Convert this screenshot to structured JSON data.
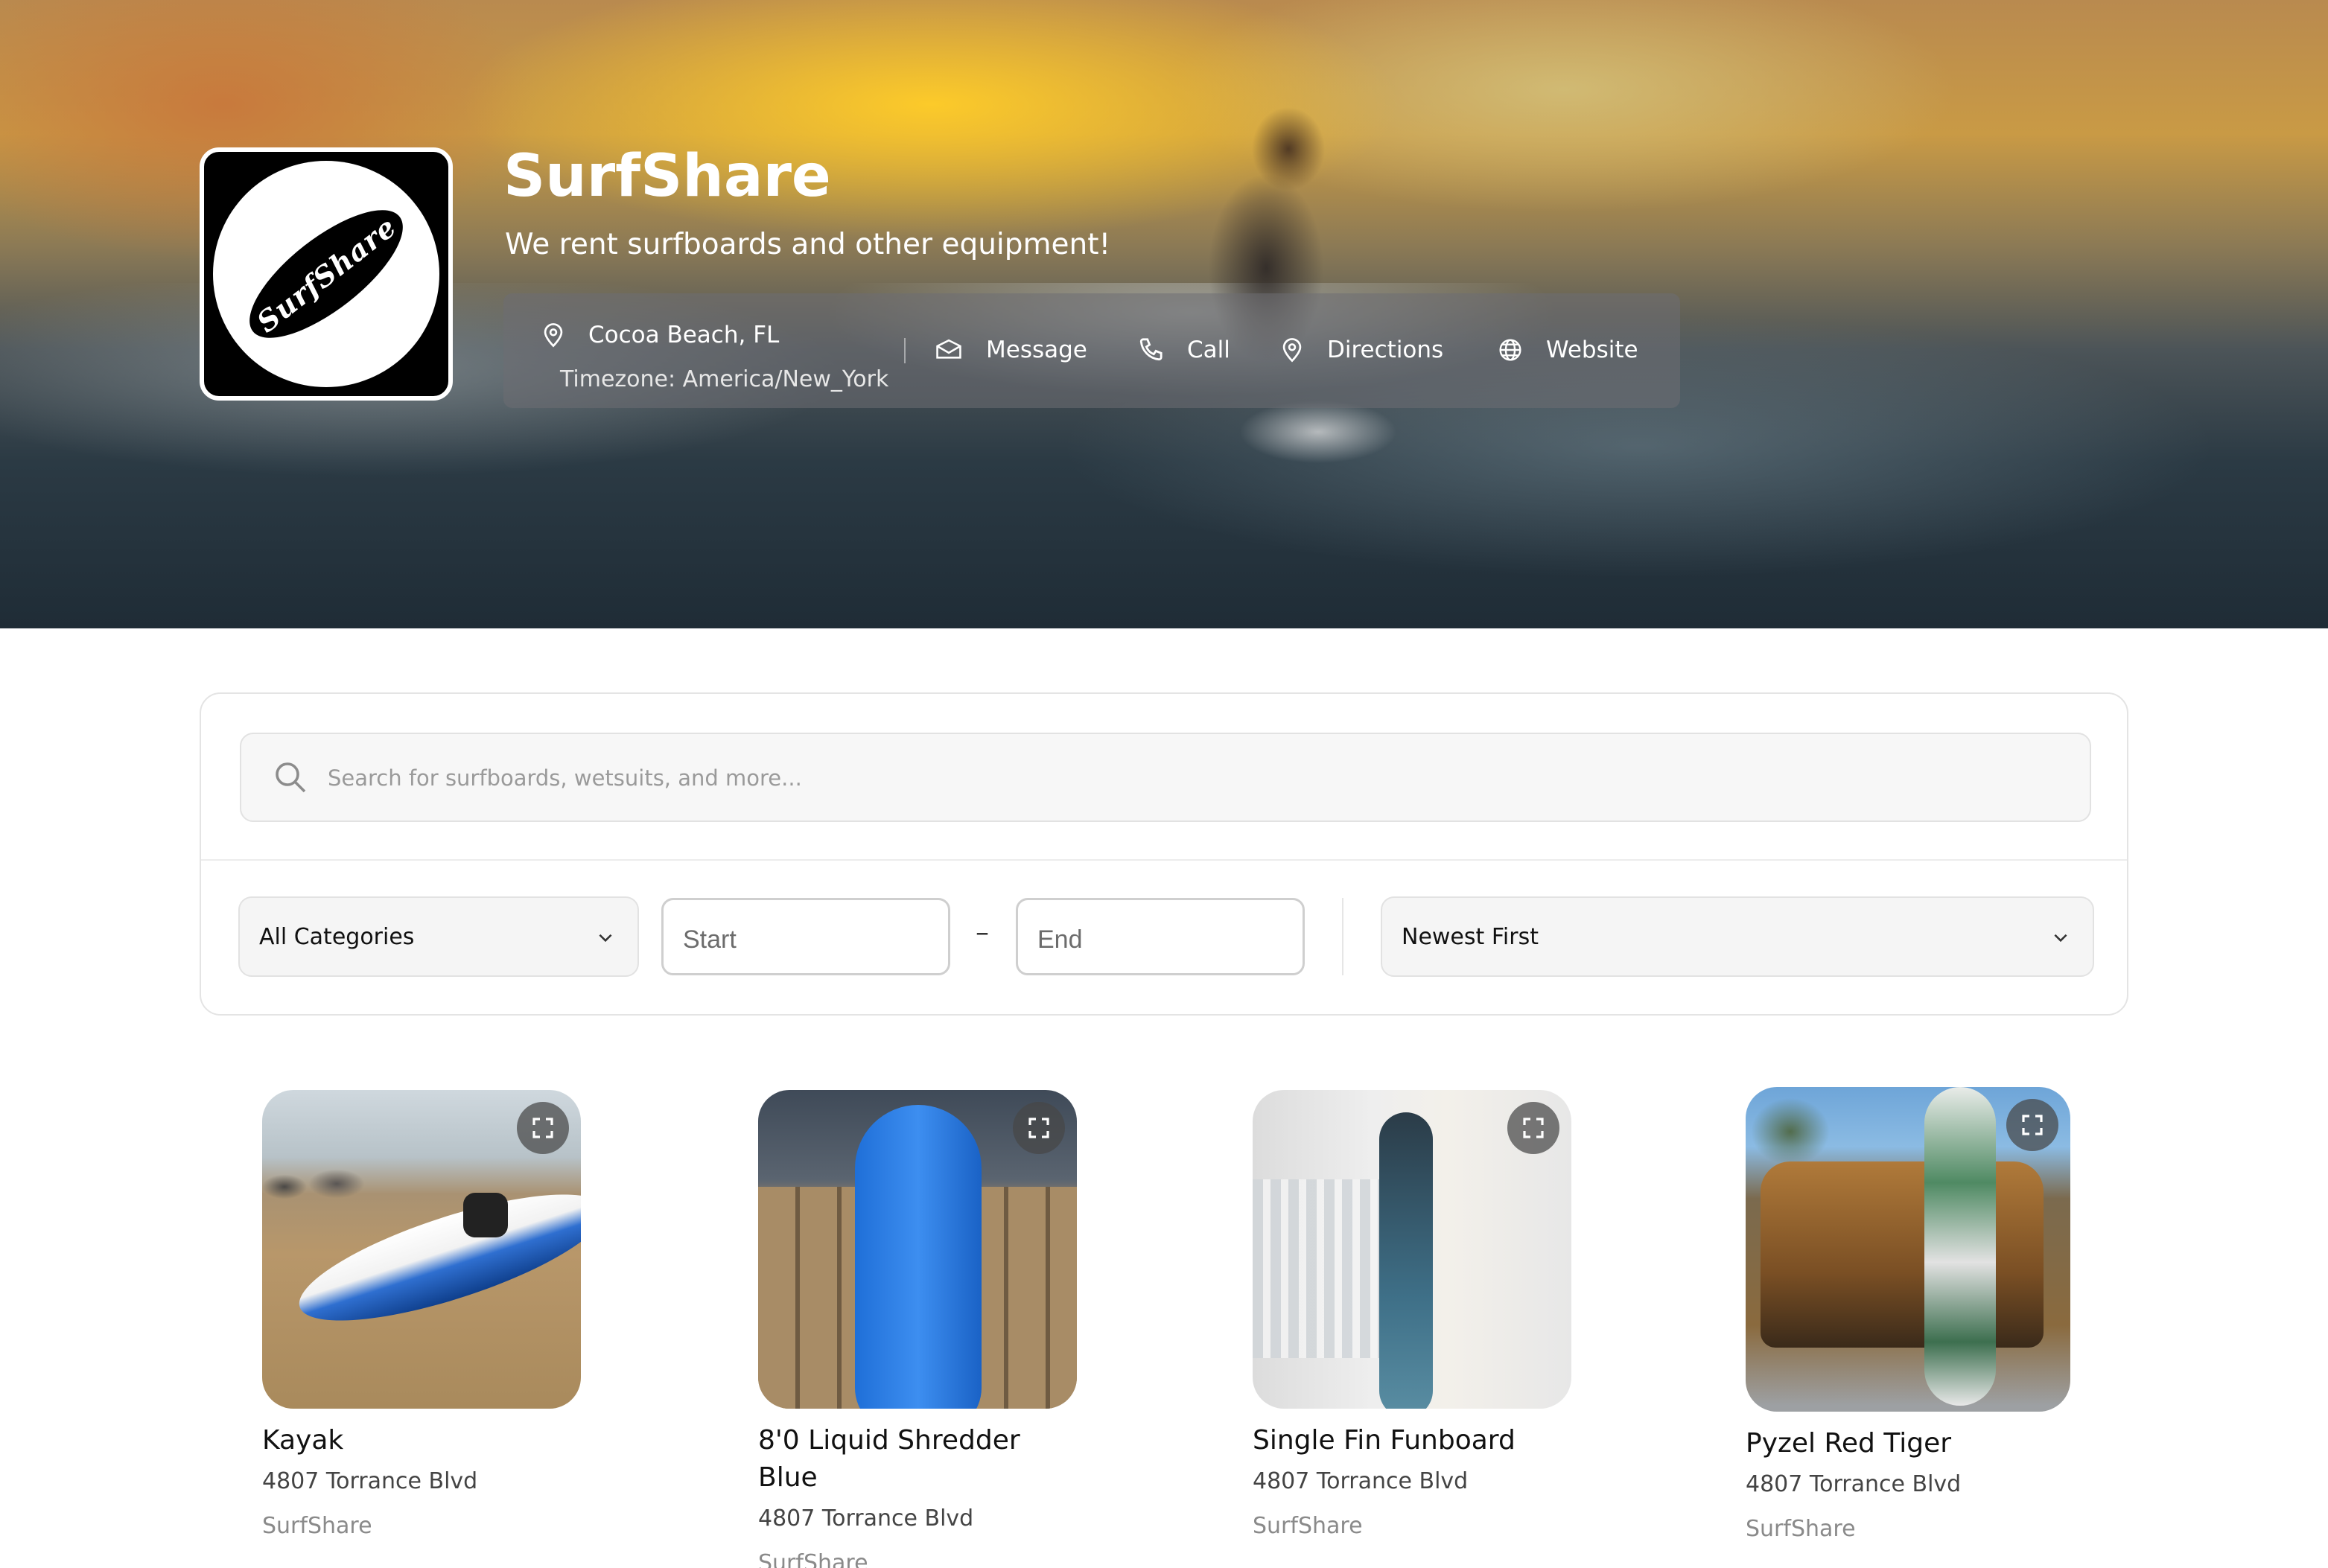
{
  "brand": {
    "name": "SurfShare",
    "tagline": "We rent surfboards and other equipment!",
    "logo_text": "SurfShare"
  },
  "info_bar": {
    "location": "Cocoa Beach, FL",
    "timezone": "Timezone: America/New_York",
    "message_label": "Message",
    "call_label": "Call",
    "directions_label": "Directions",
    "website_label": "Website"
  },
  "search": {
    "placeholder": "Search for surfboards, wetsuits, and more..."
  },
  "filters": {
    "category_value": "All Categories",
    "start_placeholder": "Start",
    "date_separator": "–",
    "end_placeholder": "End",
    "sort_value": "Newest First"
  },
  "listings": [
    {
      "title": "Kayak",
      "address": "4807 Torrance Blvd",
      "owner": "SurfShare"
    },
    {
      "title": "8'0 Liquid Shredder Blue",
      "address": "4807 Torrance Blvd",
      "owner": "SurfShare"
    },
    {
      "title": "Single Fin Funboard",
      "address": "4807 Torrance Blvd",
      "owner": "SurfShare"
    },
    {
      "title": "Pyzel Red Tiger",
      "address": "4807 Torrance Blvd",
      "owner": "SurfShare"
    }
  ],
  "colors": {
    "panel_border": "#e4e4e4",
    "info_bar_bg": "rgba(110,110,115,0.55)",
    "text_primary": "#111111",
    "text_muted": "#8a8a8a"
  },
  "icons": [
    "location-pin-icon",
    "envelope-icon",
    "phone-icon",
    "directions-pin-icon",
    "globe-icon",
    "search-icon",
    "chevron-down-icon",
    "expand-icon"
  ]
}
